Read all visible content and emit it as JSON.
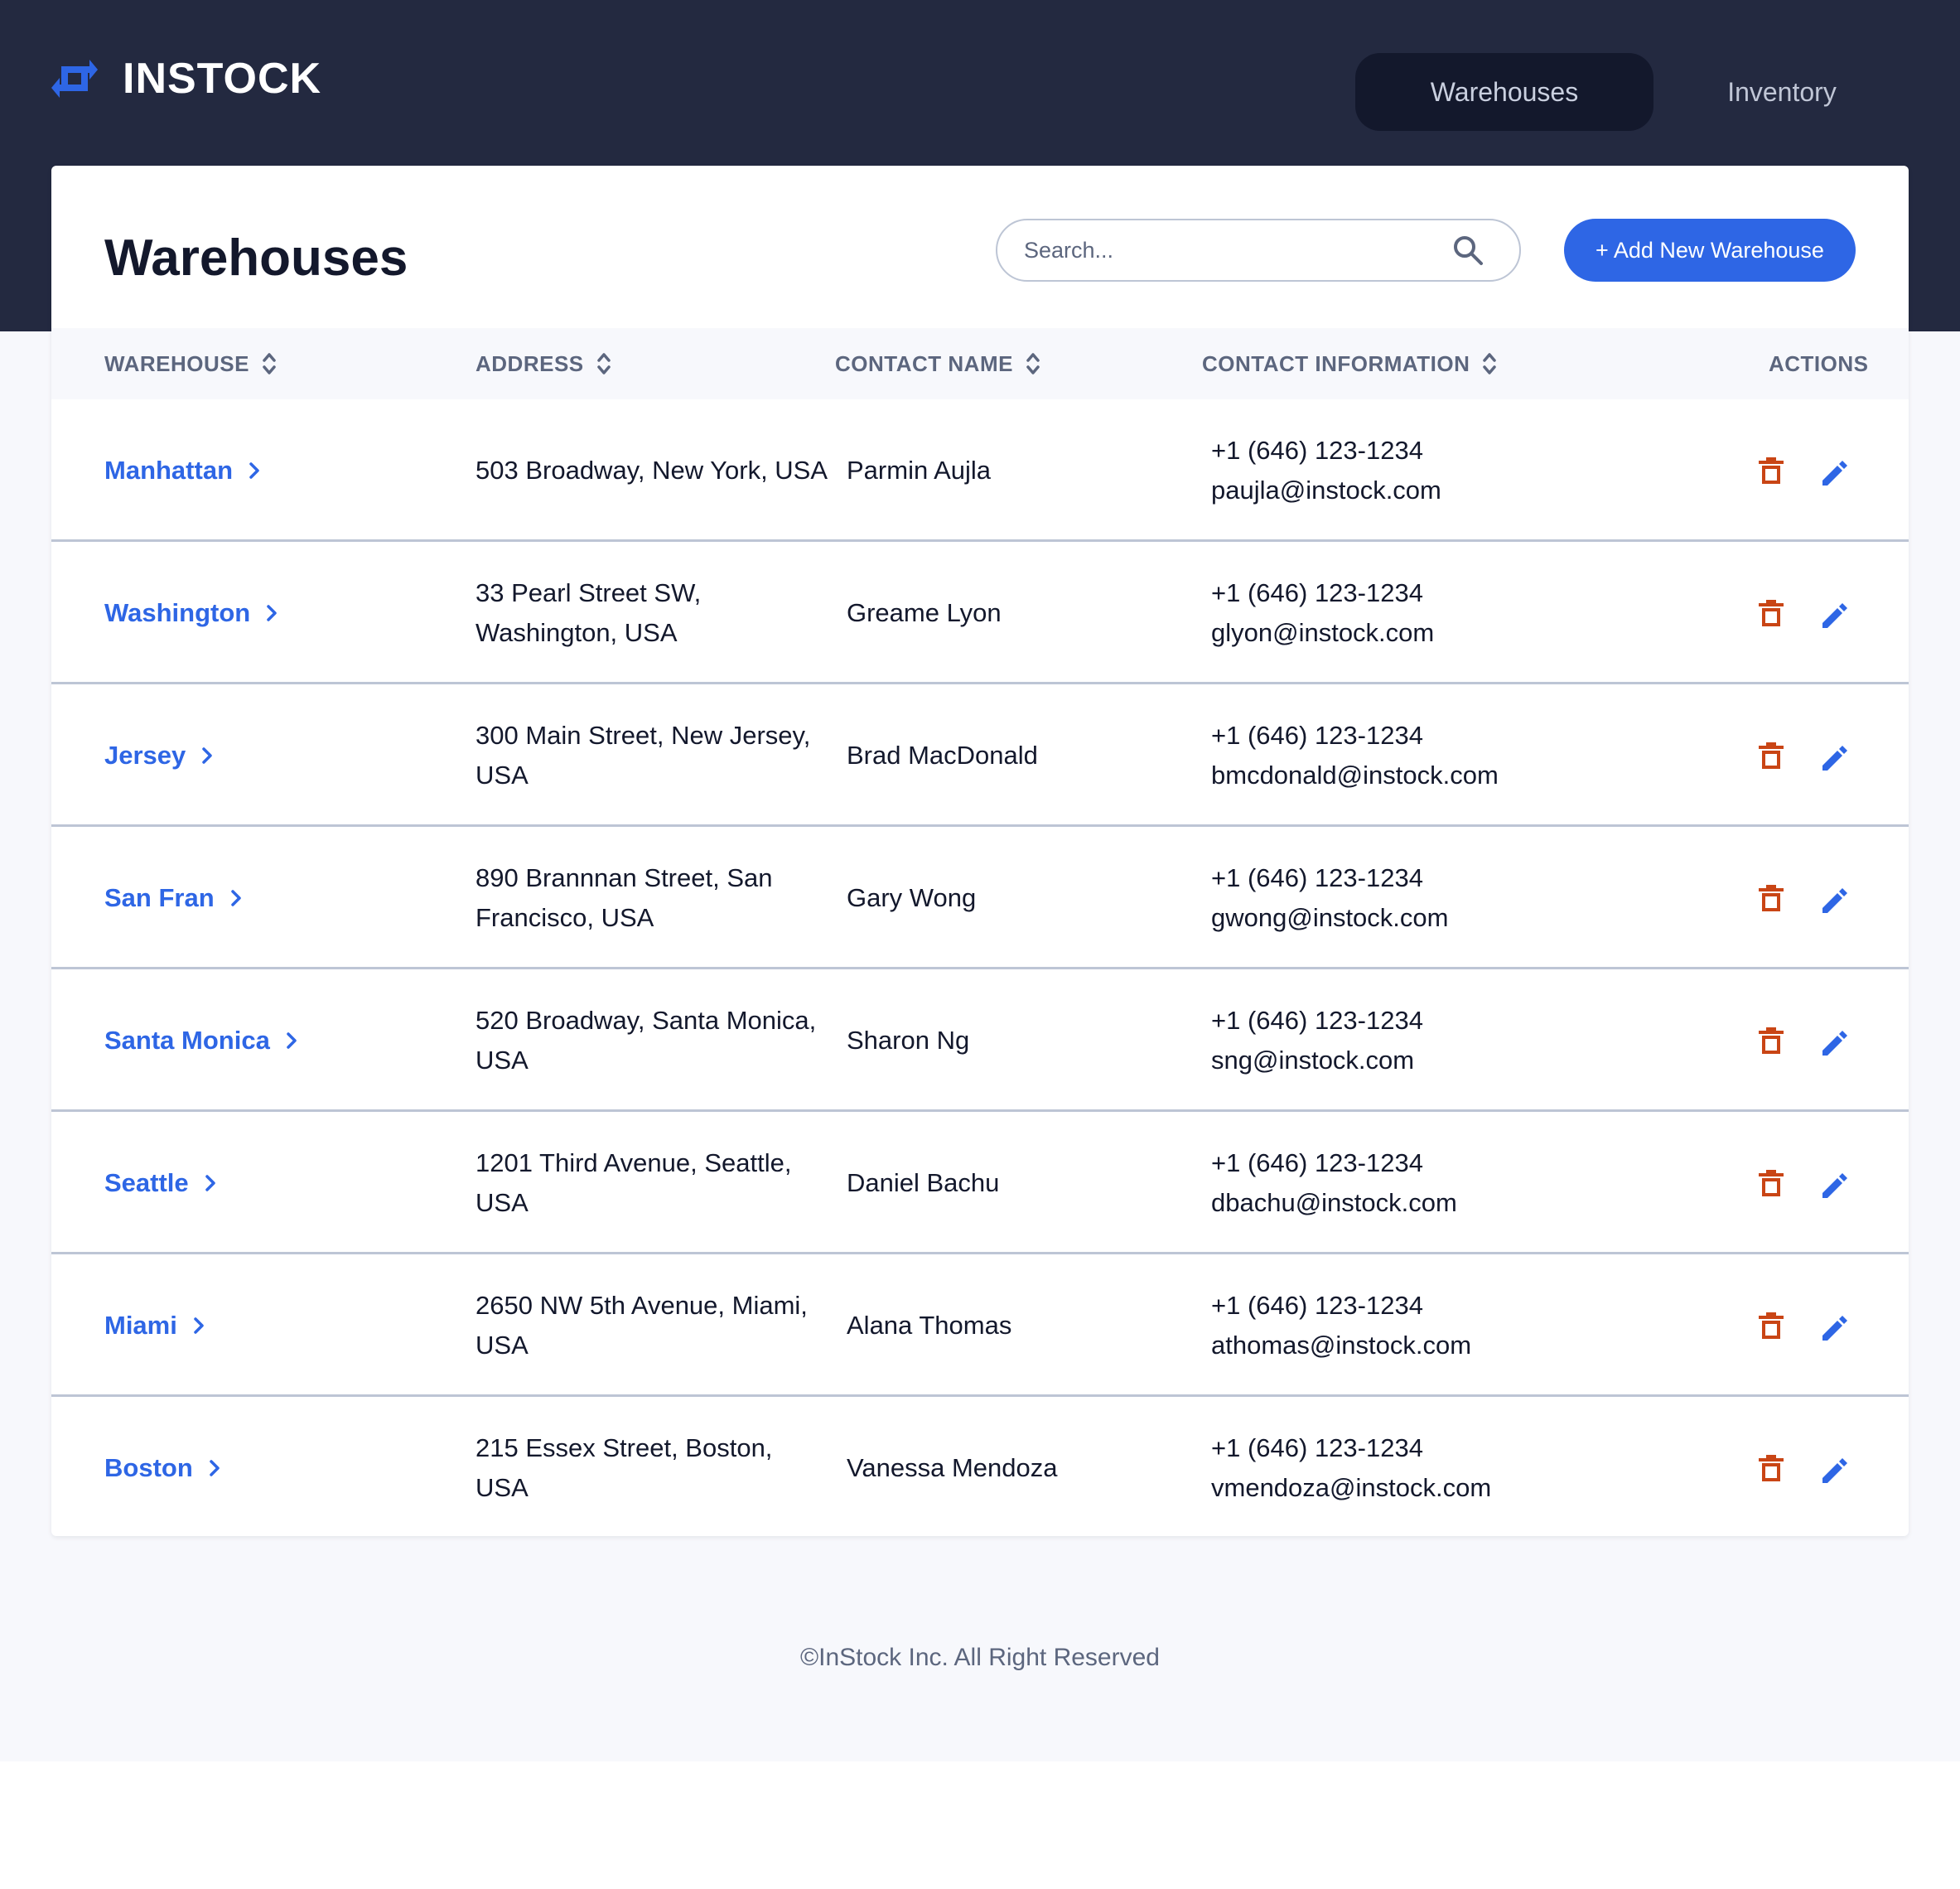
{
  "app": {
    "name": "INSTOCK",
    "nav": [
      {
        "label": "Warehouses",
        "active": true
      },
      {
        "label": "Inventory",
        "active": false
      }
    ]
  },
  "page": {
    "title": "Warehouses",
    "search_placeholder": "Search...",
    "add_button": "+ Add New Warehouse"
  },
  "table": {
    "columns": [
      "WAREHOUSE",
      "ADDRESS",
      "CONTACT NAME",
      "CONTACT INFORMATION",
      "ACTIONS"
    ],
    "rows": [
      {
        "warehouse": "Manhattan",
        "address_line1": "503 Broadway, New York, USA",
        "address_line2": "",
        "contact_name": "Parmin Aujla",
        "phone": "+1 (646) 123-1234",
        "email": "paujla@instock.com"
      },
      {
        "warehouse": "Washington",
        "address_line1": "33 Pearl Street SW,",
        "address_line2": "Washington, USA",
        "contact_name": "Greame Lyon",
        "phone": "+1 (646) 123-1234",
        "email": "glyon@instock.com"
      },
      {
        "warehouse": "Jersey",
        "address_line1": "300 Main Street, New Jersey,",
        "address_line2": "USA",
        "contact_name": "Brad MacDonald",
        "phone": "+1 (646) 123-1234",
        "email": "bmcdonald@instock.com"
      },
      {
        "warehouse": "San Fran",
        "address_line1": "890 Brannnan Street, San",
        "address_line2": "Francisco, USA",
        "contact_name": "Gary Wong",
        "phone": "+1 (646) 123-1234",
        "email": "gwong@instock.com"
      },
      {
        "warehouse": "Santa Monica",
        "address_line1": "520 Broadway, Santa Monica,",
        "address_line2": "USA",
        "contact_name": "Sharon Ng",
        "phone": "+1 (646) 123-1234",
        "email": "sng@instock.com"
      },
      {
        "warehouse": "Seattle",
        "address_line1": "1201 Third Avenue, Seattle,",
        "address_line2": "USA",
        "contact_name": "Daniel Bachu",
        "phone": "+1 (646) 123-1234",
        "email": "dbachu@instock.com"
      },
      {
        "warehouse": "Miami",
        "address_line1": "2650 NW 5th Avenue, Miami,",
        "address_line2": "USA",
        "contact_name": "Alana Thomas",
        "phone": "+1 (646) 123-1234",
        "email": "athomas@instock.com"
      },
      {
        "warehouse": "Boston",
        "address_line1": "215 Essex Street, Boston, USA",
        "address_line2": "",
        "contact_name": "Vanessa Mendoza",
        "phone": "+1 (646) 123-1234",
        "email": "vmendoza@instock.com"
      }
    ]
  },
  "footer": {
    "text": "©InStock Inc. All Right Reserved"
  },
  "colors": {
    "header_bg": "#232940",
    "primary": "#2e66e5",
    "delete": "#c94515",
    "muted": "#5c667e",
    "divider": "#bdc5d5"
  },
  "icons": {
    "logo": "swap-arrows-icon",
    "search": "search-icon",
    "sort": "sort-icon",
    "chevron": "chevron-right-icon",
    "delete": "trash-icon",
    "edit": "pencil-icon"
  }
}
